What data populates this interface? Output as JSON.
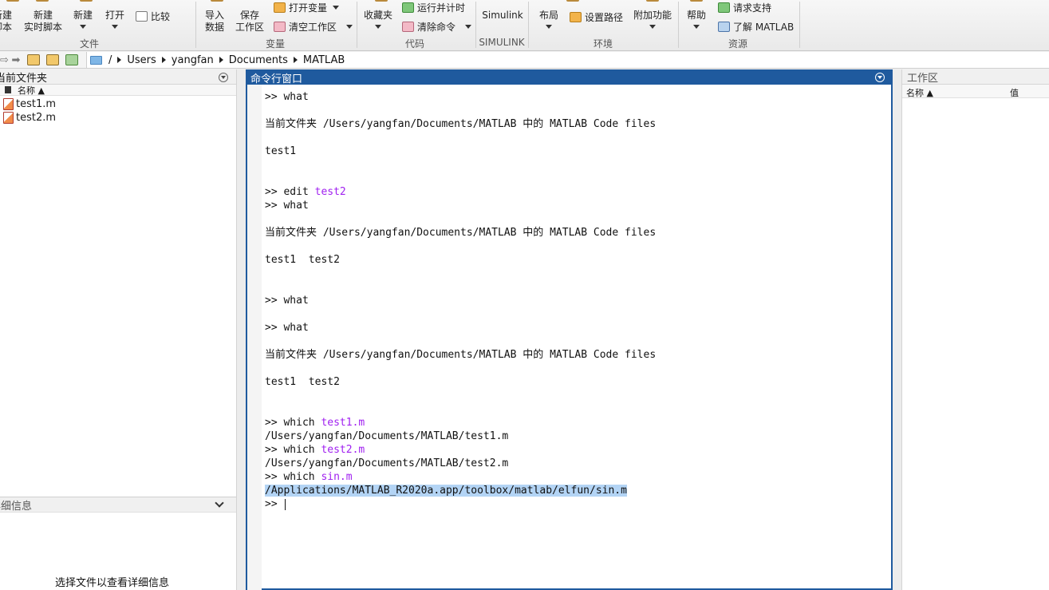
{
  "toolstrip": {
    "new_script_l1": "新建",
    "new_script_l2": "脚本",
    "new_live_l1": "新建",
    "new_live_l2": "实时脚本",
    "new": "新建",
    "open": "打开",
    "compare": "比较",
    "import_l1": "导入",
    "import_l2": "数据",
    "save_l1": "保存",
    "save_l2": "工作区",
    "open_var": "打开变量",
    "clear_ws": "清空工作区",
    "favorites": "收藏夹",
    "run_timed": "运行并计时",
    "clear_cmd": "清除命令",
    "simulink": "Simulink",
    "layout": "布局",
    "set_path": "设置路径",
    "addons": "附加功能",
    "help": "帮助",
    "request_support": "请求支持",
    "learn_matlab": "了解 MATLAB",
    "groups": {
      "file": "文件",
      "variable": "变量",
      "code": "代码",
      "simulink": "SIMULINK",
      "environment": "环境",
      "resources": "资源"
    }
  },
  "address": {
    "crumbs": [
      "/",
      "Users",
      "yangfan",
      "Documents",
      "MATLAB"
    ]
  },
  "current_folder": {
    "title": "当前文件夹",
    "column_name": "名称 ▲",
    "files": [
      "test1.m",
      "test2.m"
    ],
    "details_title": "详细信息",
    "details_message": "选择文件以查看详细信息"
  },
  "command_window": {
    "title": "命令行窗口",
    "lines": [
      {
        "text": ">> what"
      },
      {
        "text": ""
      },
      {
        "text": "当前文件夹 /Users/yangfan/Documents/MATLAB 中的 MATLAB Code files"
      },
      {
        "text": ""
      },
      {
        "text": "test1"
      },
      {
        "text": ""
      },
      {
        "text": ""
      },
      {
        "text": ">> edit ",
        "arg": "test2"
      },
      {
        "text": ">> what"
      },
      {
        "text": ""
      },
      {
        "text": "当前文件夹 /Users/yangfan/Documents/MATLAB 中的 MATLAB Code files"
      },
      {
        "text": ""
      },
      {
        "text": "test1  test2"
      },
      {
        "text": ""
      },
      {
        "text": ""
      },
      {
        "text": ">> what"
      },
      {
        "text": ""
      },
      {
        "text": ">> what"
      },
      {
        "text": ""
      },
      {
        "text": "当前文件夹 /Users/yangfan/Documents/MATLAB 中的 MATLAB Code files"
      },
      {
        "text": ""
      },
      {
        "text": "test1  test2"
      },
      {
        "text": ""
      },
      {
        "text": ""
      },
      {
        "text": ">> which ",
        "arg": "test1.m"
      },
      {
        "text": "/Users/yangfan/Documents/MATLAB/test1.m"
      },
      {
        "text": ">> which ",
        "arg": "test2.m"
      },
      {
        "text": "/Users/yangfan/Documents/MATLAB/test2.m"
      },
      {
        "text": ">> which ",
        "arg": "sin.m"
      },
      {
        "text": "/Applications/MATLAB_R2020a.app/toolbox/matlab/elfun/sin.m",
        "selected": true
      },
      {
        "text": ">> ",
        "cursor": true
      }
    ]
  },
  "workspace": {
    "title": "工作区",
    "col_name": "名称 ▲",
    "col_value": "值"
  }
}
